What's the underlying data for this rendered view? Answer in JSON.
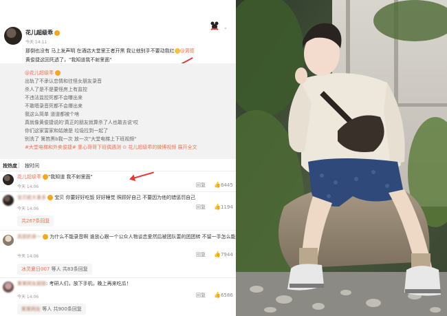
{
  "post": {
    "username": "花儿超级乖",
    "time": "今天 14:11",
    "text_line1": "那倒也没有 马上发声明 在酒店大堂里王者开黑 我让他别手不要动我红",
    "mention": "@男德",
    "text_line2": "黄俊捷这回死透了，\"我知道我不射里面\""
  },
  "repost": {
    "author": "@花儿超级乖",
    "lines": [
      "出轨了不承认恋情和往怪女朋友录音",
      "杀人了是不是要怪房上有监控",
      "不违法监控死都不会曝出来",
      "不敢嗯录音死都不会爆出来",
      "我这么简单 道道都被个啥",
      "真就像黄俊捷说的'真正的朋友就算杀了人也敢去说'哎",
      "你们这家富家和姑娘是 垃圾拉到一起了",
      "别洗了 篱笆黑b我一次 放一次\"大堂电梯上下班视频\""
    ],
    "last_line": "#大堂电梯和外卖俊捷# 重心哥哥下班偶遇测",
    "link_text": "花儿超级乖的微博视频",
    "full_text": "展开全文"
  },
  "tabs": {
    "hot": "按热度",
    "time": "按时间"
  },
  "comments": [
    {
      "username": "花儿超级乖",
      "text": "\"我知道 我不射里面\"",
      "time": "今天 14:06",
      "reply": "回复",
      "likes": "6445"
    },
    {
      "username": "宝贝妮大事多",
      "text": "宝贝 你要好好吃饭 好好睡觉 照顾好自己 不要因为他的错惩罚自己",
      "time": "今天 14:06",
      "reply": "回复",
      "likes": "1194",
      "more_replies": "共267条回复"
    },
    {
      "username": "高原奶茶一",
      "text": "为什么不能录音啊 谁放心跟一个公众人物谈恋爱然后被团队耍的团团转 不留一手怎么能行 真就受害者有罪论了",
      "time": "今天 14:06",
      "reply": "回复",
      "likes": "7944",
      "replier": "冰灵夏日007",
      "more_replies": "等人 共83条回复"
    },
    {
      "username": "某某网友甜甜",
      "text": "考研人们，放下手机，晚上再来吃瓜！",
      "time": "今天 14:06",
      "reply": "回复",
      "likes": "6586",
      "replier": "某某网友",
      "more_replies": "等人 共900条回复"
    }
  ],
  "icons": {
    "like": "thumbs-up-icon",
    "badge": "vip-badge-icon",
    "arrow": "red-arrow-annotation"
  },
  "colors": {
    "link": "#eb7350",
    "repost_bg": "#f2f2f2",
    "arrow": "#e53935"
  }
}
